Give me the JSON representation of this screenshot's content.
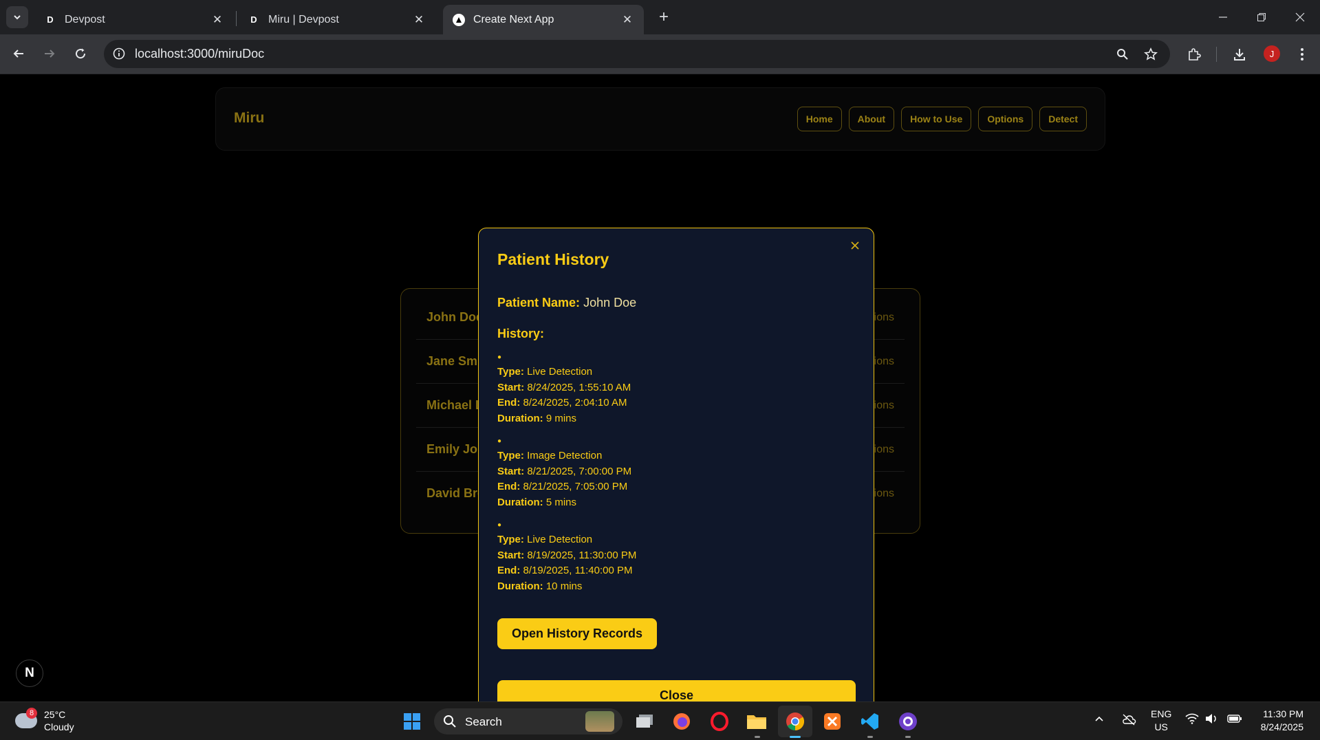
{
  "browser": {
    "tabs": [
      {
        "title": "Devpost",
        "favicon": "D"
      },
      {
        "title": "Miru | Devpost",
        "favicon": "D"
      },
      {
        "title": "Create Next App",
        "favicon": "next-logo",
        "active": true
      }
    ],
    "url": "localhost:3000/miruDoc",
    "profile_initial": "J"
  },
  "site": {
    "brand": "Miru",
    "nav": [
      "Home",
      "About",
      "How to Use",
      "Options",
      "Detect"
    ]
  },
  "patients": [
    {
      "name": "John Doe",
      "options": "Options"
    },
    {
      "name": "Jane Smith",
      "options": "Options"
    },
    {
      "name": "Michael Lee",
      "options": "Options"
    },
    {
      "name": "Emily Johnson",
      "options": "Options"
    },
    {
      "name": "David Brown",
      "options": "Options"
    }
  ],
  "modal": {
    "title": "Patient History",
    "patient_name_label": "Patient Name:",
    "patient_name": "John Doe",
    "history_label": "History:",
    "labels": {
      "type": "Type:",
      "start": "Start:",
      "end": "End:",
      "duration": "Duration:"
    },
    "entries": [
      {
        "type": "Live Detection",
        "start": "8/24/2025, 1:55:10 AM",
        "end": "8/24/2025, 2:04:10 AM",
        "duration": "9 mins"
      },
      {
        "type": "Image Detection",
        "start": "8/21/2025, 7:00:00 PM",
        "end": "8/21/2025, 7:05:00 PM",
        "duration": "5 mins"
      },
      {
        "type": "Live Detection",
        "start": "8/19/2025, 11:30:00 PM",
        "end": "8/19/2025, 11:40:00 PM",
        "duration": "10 mins"
      }
    ],
    "open_records_label": "Open History Records",
    "close_label": "Close"
  },
  "next_badge": "N",
  "taskbar": {
    "weather_temp": "25°C",
    "weather_desc": "Cloudy",
    "weather_badge": "8",
    "search_label": "Search",
    "lang_line1": "ENG",
    "lang_line2": "US",
    "time": "11:30 PM",
    "date": "8/24/2025"
  },
  "colors": {
    "accent": "#facc15",
    "modal_bg": "#0f172a",
    "page_bg": "#000000"
  }
}
